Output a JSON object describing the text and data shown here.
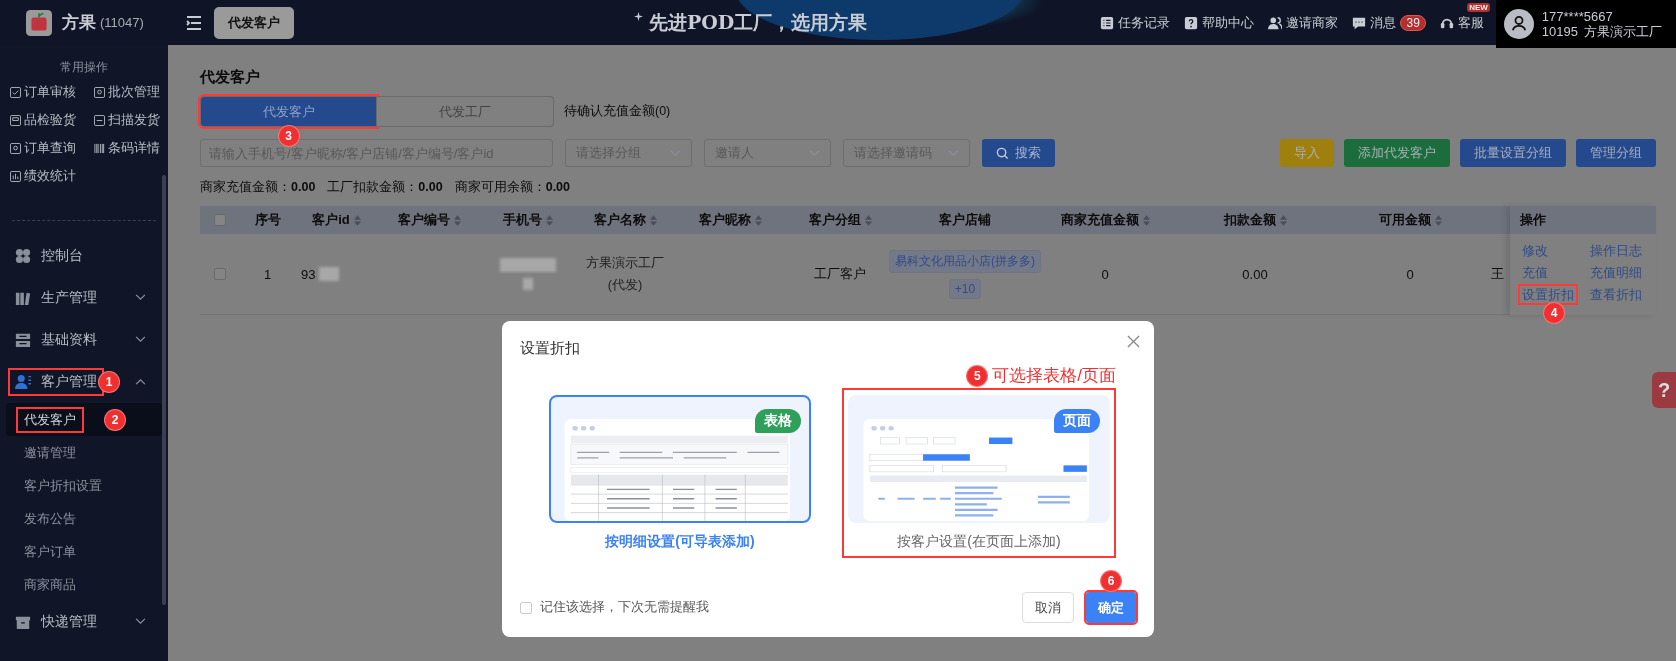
{
  "topbar": {
    "logo": "方果",
    "logo_count": "(11047)",
    "open_tab": "代发客户",
    "slogan": "先进POD工厂，选用方果",
    "links": [
      {
        "label": "任务记录",
        "kind": "tasks"
      },
      {
        "label": "帮助中心",
        "kind": "help"
      },
      {
        "label": "邀请商家",
        "kind": "invite"
      },
      {
        "label": "消息",
        "kind": "message",
        "count": "39"
      },
      {
        "label": "客服",
        "kind": "service",
        "badge": "NEW"
      }
    ],
    "user": {
      "phone": "177****5667",
      "id": "10195",
      "company": "方果演示工厂"
    }
  },
  "sidebar": {
    "quick_title": "常用操作",
    "quick": [
      {
        "label": "订单审核",
        "kind": "check"
      },
      {
        "label": "批次管理",
        "kind": "batch"
      },
      {
        "label": "品检验货",
        "kind": "inspect"
      },
      {
        "label": "扫描发货",
        "kind": "scan"
      },
      {
        "label": "订单查询",
        "kind": "search"
      },
      {
        "label": "条码详情",
        "kind": "barcode"
      },
      {
        "label": "绩效统计",
        "kind": "stats"
      }
    ],
    "menu": [
      {
        "label": "控制台",
        "kind": "dashboard"
      },
      {
        "label": "生产管理",
        "kind": "production",
        "expanded": false
      },
      {
        "label": "基础资料",
        "kind": "basic",
        "expanded": false
      },
      {
        "label": "客户管理",
        "kind": "customer",
        "expanded": true,
        "callout": "1",
        "children": [
          {
            "label": "代发客户",
            "selected": true,
            "callout": "2"
          },
          {
            "label": "邀请管理",
            "selected": false
          },
          {
            "label": "客户折扣设置",
            "selected": false
          },
          {
            "label": "发布公告",
            "selected": false
          },
          {
            "label": "客户订单",
            "selected": false
          },
          {
            "label": "商家商品",
            "selected": false
          }
        ]
      },
      {
        "label": "快递管理",
        "kind": "express",
        "expanded": false
      }
    ]
  },
  "page": {
    "title": "代发客户",
    "tabs": [
      {
        "label": "代发客户",
        "selected": true,
        "callout": "3"
      },
      {
        "label": "代发工厂",
        "selected": false
      }
    ],
    "pending": "待确认充值金额(0)",
    "search": {
      "placeholder": "请输入手机号/客户昵称/客户店铺/客户编号/客户id"
    },
    "selects": [
      {
        "placeholder": "请选择分组"
      },
      {
        "placeholder": "邀请人"
      },
      {
        "placeholder": "请选择邀请码"
      }
    ],
    "search_button": "搜索",
    "actions": [
      {
        "label": "导入",
        "kind": "warning"
      },
      {
        "label": "添加代发客户",
        "kind": "success"
      },
      {
        "label": "批量设置分组",
        "kind": "primary"
      },
      {
        "label": "管理分组",
        "kind": "primary"
      }
    ],
    "summary": [
      {
        "label": "商家充值金额：",
        "value": "0.00"
      },
      {
        "label": "工厂扣款金额：",
        "value": "0.00"
      },
      {
        "label": "商家可用余额：",
        "value": "0.00"
      }
    ],
    "table": {
      "columns": [
        {
          "label": "序号",
          "sortable": false
        },
        {
          "label": "客户id",
          "sortable": true
        },
        {
          "label": "客户编号",
          "sortable": true
        },
        {
          "label": "手机号",
          "sortable": true
        },
        {
          "label": "客户名称",
          "sortable": true
        },
        {
          "label": "客户昵称",
          "sortable": true
        },
        {
          "label": "客户分组",
          "sortable": true
        },
        {
          "label": "客户店铺",
          "sortable": false
        },
        {
          "label": "商家充值金额",
          "sortable": true
        },
        {
          "label": "扣款金额",
          "sortable": true
        },
        {
          "label": "可用金额",
          "sortable": true
        }
      ],
      "all_checked": false,
      "ops_title": "操作",
      "rows": [
        {
          "checked": false,
          "index": "1",
          "customer_id": "93",
          "name": "方果演示工厂(代发)",
          "group": "工厂客户",
          "shops": [
            "易科文化用品小店(拼多多)",
            "+10"
          ],
          "recharge": "0",
          "deduct": "0.00",
          "available": "0",
          "column_13": "王",
          "ops": [
            {
              "label": "修改"
            },
            {
              "label": "操作日志"
            },
            {
              "label": "充值"
            },
            {
              "label": "充值明细"
            },
            {
              "label": "设置折扣",
              "callout": "4"
            },
            {
              "label": "查看折扣"
            }
          ]
        }
      ]
    }
  },
  "help_tab": "?",
  "modal": {
    "title": "设置折扣",
    "options": [
      {
        "kind": "spreadsheet",
        "badge": "表格",
        "label": "按明细设置(可导表添加)",
        "selected": true
      },
      {
        "kind": "page",
        "badge": "页面",
        "label": "按客户设置(在页面上添加)",
        "selected": false,
        "callout": "5",
        "callout_note": "可选择表格/页面"
      }
    ],
    "remember": {
      "label": "记住该选择，下次无需提醒我",
      "checked": false
    },
    "cancel": "取消",
    "confirm": {
      "label": "确定",
      "callout": "6"
    }
  }
}
